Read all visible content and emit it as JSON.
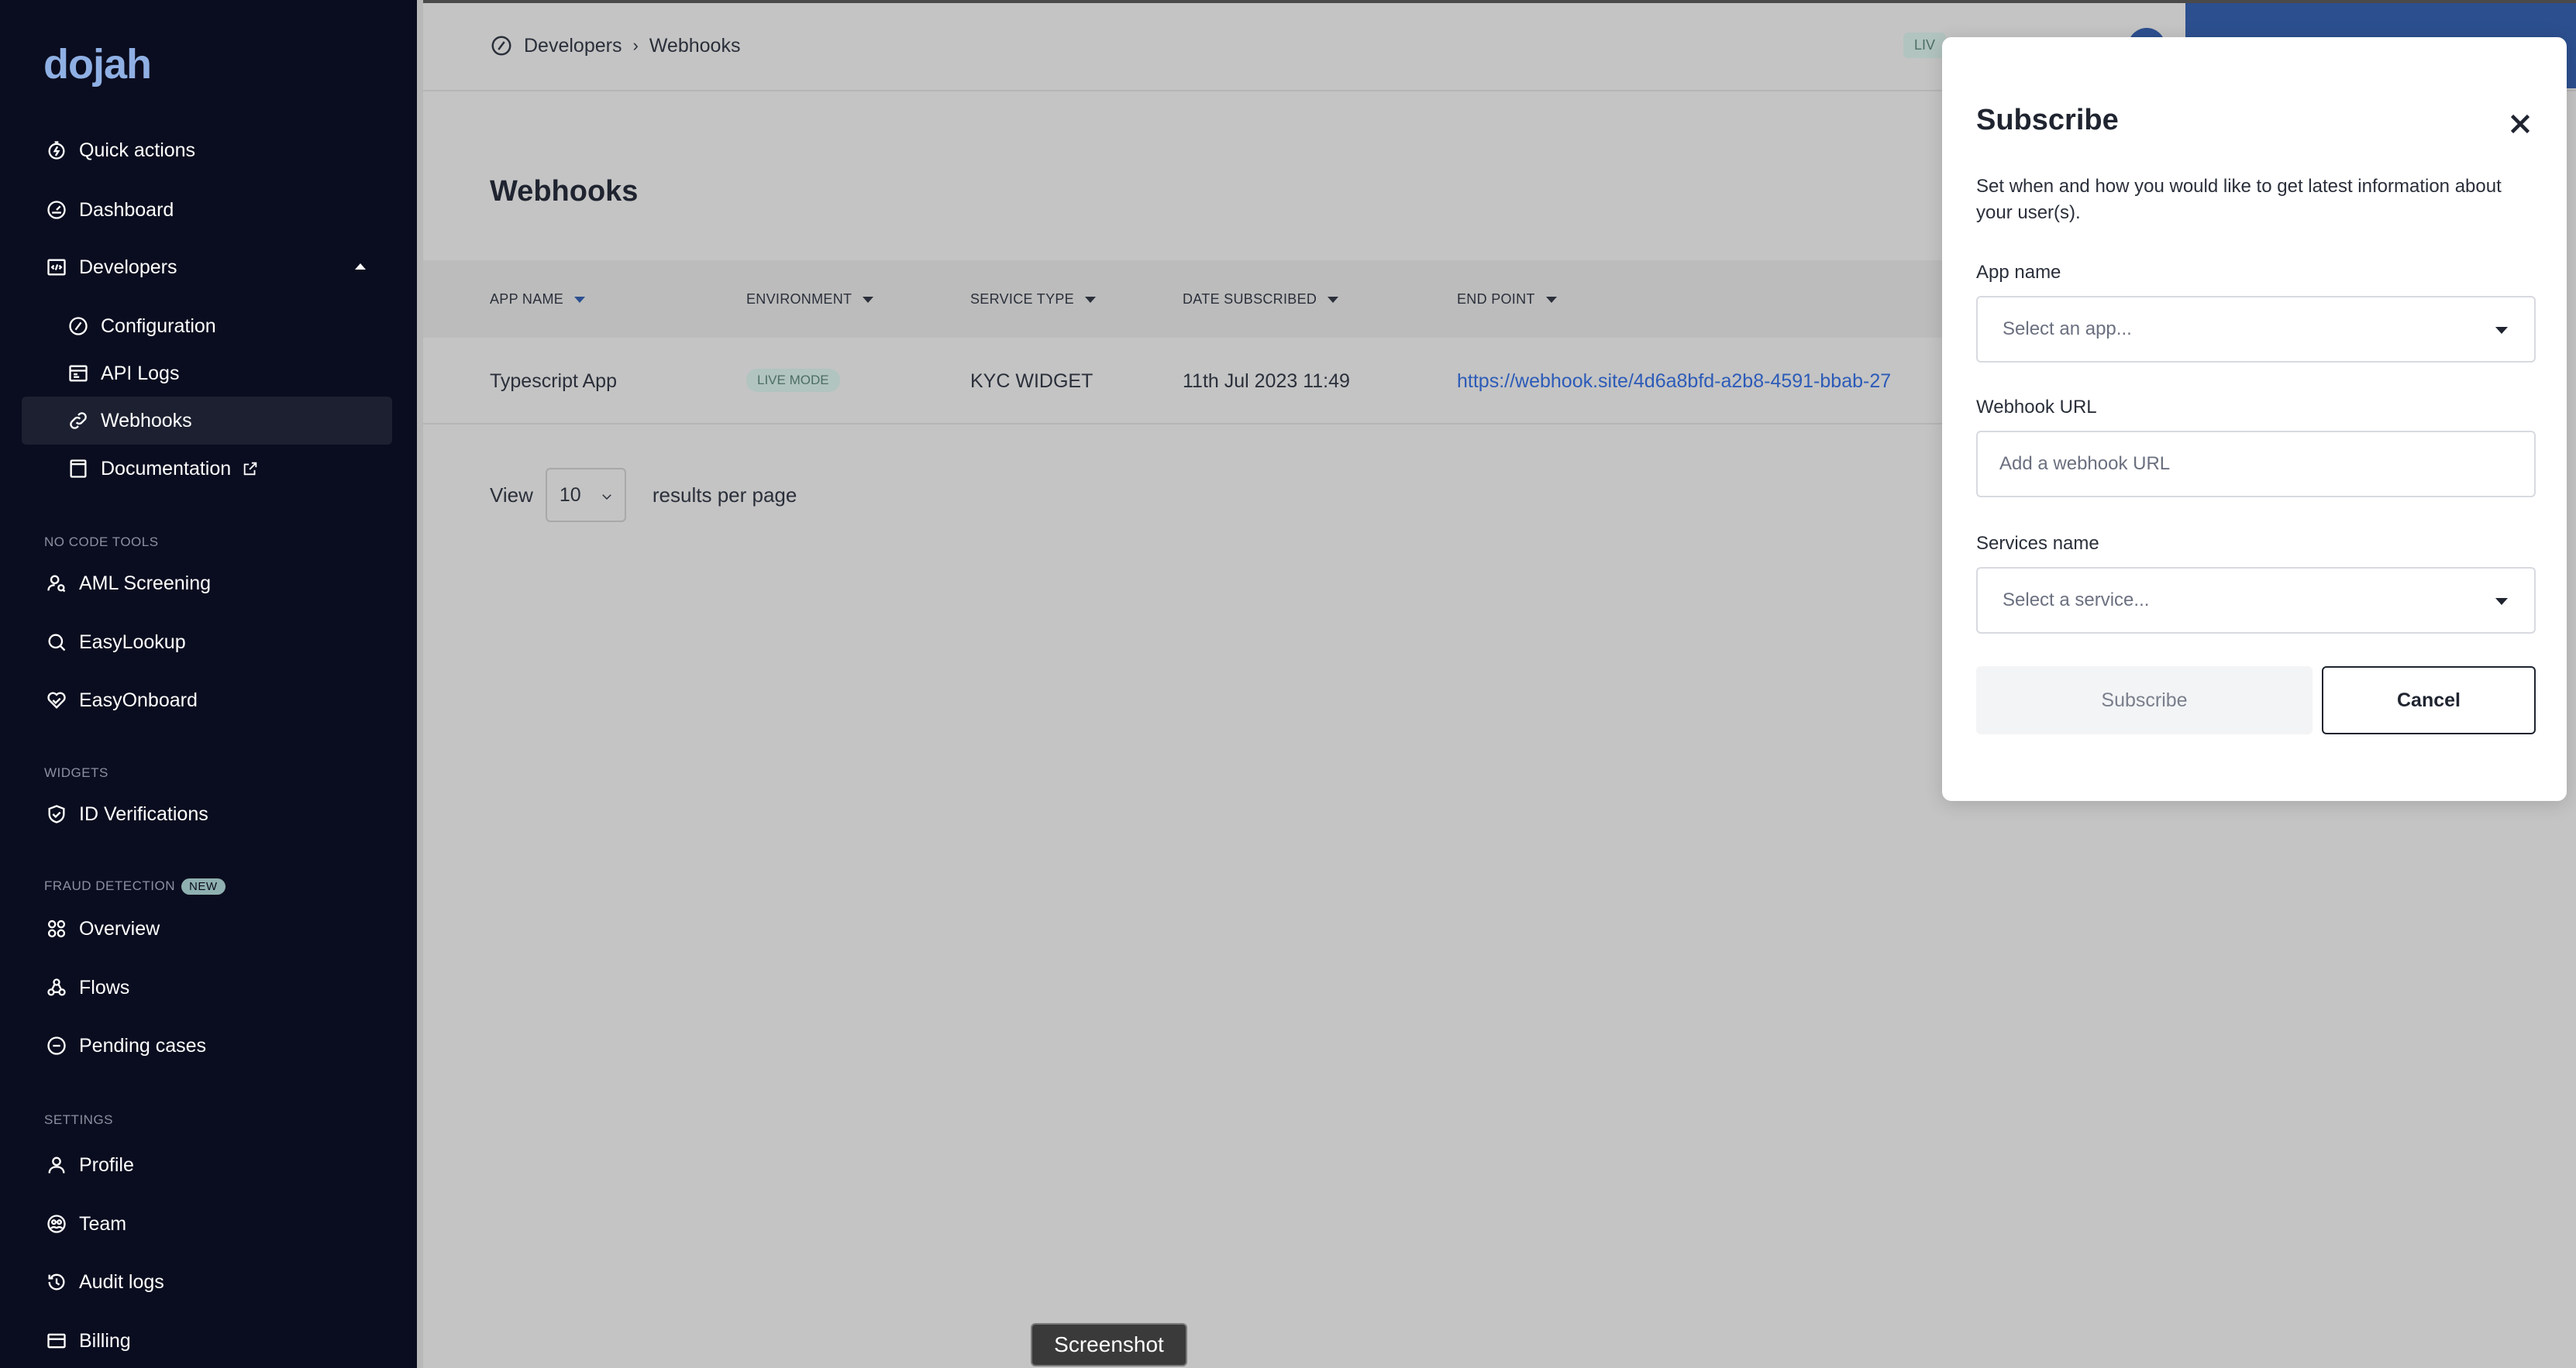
{
  "logo": "dojah",
  "sidebar": {
    "items": [
      {
        "label": "Quick actions",
        "icon": "lightning-circle-icon"
      },
      {
        "label": "Dashboard",
        "icon": "gauge-icon"
      },
      {
        "label": "Developers",
        "icon": "code-window-icon"
      },
      {
        "label": "Configuration",
        "icon": "diamond-icon"
      },
      {
        "label": "API Logs",
        "icon": "browser-icon"
      },
      {
        "label": "Webhooks",
        "icon": "link-icon"
      },
      {
        "label": "Documentation",
        "icon": "book-icon"
      }
    ],
    "no_code_label": "NO CODE TOOLS",
    "no_code_items": [
      {
        "label": "AML Screening",
        "icon": "user-search-icon"
      },
      {
        "label": "EasyLookup",
        "icon": "search-icon"
      },
      {
        "label": "EasyOnboard",
        "icon": "handshake-icon"
      }
    ],
    "widgets_label": "WIDGETS",
    "widget_items": [
      {
        "label": "ID Verifications",
        "icon": "shield-check-icon"
      }
    ],
    "fraud_label": "FRAUD DETECTION",
    "fraud_badge": "NEW",
    "fraud_items": [
      {
        "label": "Overview",
        "icon": "grid-icon"
      },
      {
        "label": "Flows",
        "icon": "flows-icon"
      },
      {
        "label": "Pending cases",
        "icon": "minus-circle-icon"
      }
    ],
    "settings_label": "SETTINGS",
    "settings_items": [
      {
        "label": "Profile",
        "icon": "user-icon"
      },
      {
        "label": "Team",
        "icon": "team-icon"
      },
      {
        "label": "Audit logs",
        "icon": "history-icon"
      },
      {
        "label": "Billing",
        "icon": "card-icon"
      }
    ]
  },
  "breadcrumb": {
    "parent": "Developers",
    "separator": "›",
    "current": "Webhooks"
  },
  "live_pill": "LIV",
  "page_title": "Webhooks",
  "table": {
    "columns": [
      "APP NAME",
      "ENVIRONMENT",
      "SERVICE TYPE",
      "DATE SUBSCRIBED",
      "END POINT"
    ],
    "rows": [
      {
        "app_name": "Typescript App",
        "environment": "LIVE MODE",
        "service_type": "KYC WIDGET",
        "date_subscribed": "11th Jul 2023 11:49",
        "end_point": "https://webhook.site/4d6a8bfd-a2b8-4591-bbab-27"
      }
    ]
  },
  "pager": {
    "view_label": "View",
    "per_page": "10",
    "suffix": "results per page"
  },
  "tooltip": "Screenshot",
  "modal": {
    "title": "Subscribe",
    "description": "Set when and how you would like to get latest information about your user(s).",
    "app_label": "App name",
    "app_placeholder": "Select an app...",
    "url_label": "Webhook URL",
    "url_placeholder": "Add a webhook URL",
    "service_label": "Services name",
    "service_placeholder": "Select a service...",
    "subscribe_button": "Subscribe",
    "cancel_button": "Cancel"
  }
}
